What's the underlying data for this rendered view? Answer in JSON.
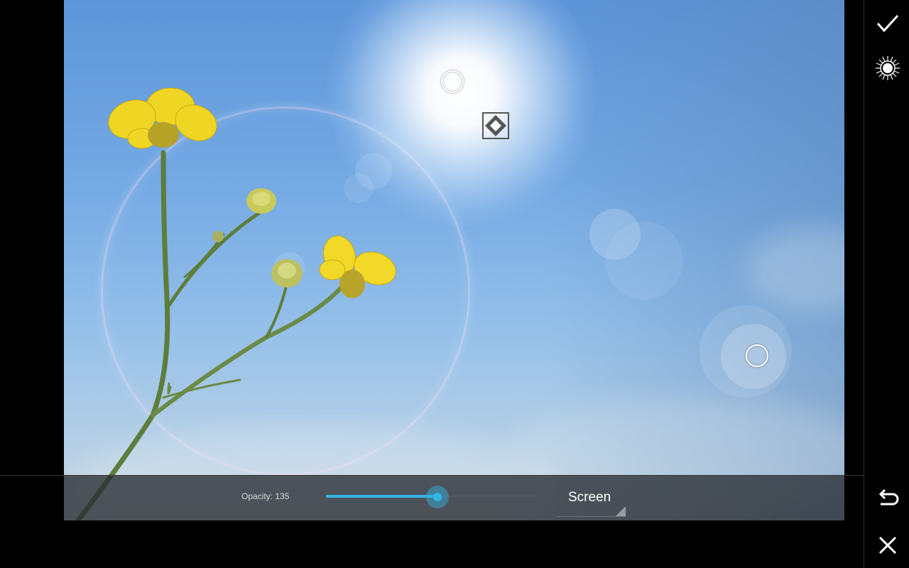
{
  "editor": {
    "opacity_label": "Opacity: 135",
    "opacity_value": 135,
    "opacity_max": 255,
    "blend_mode": "Screen",
    "accent_color": "#33b5e5"
  },
  "toolbar": {
    "apply_icon": "check-icon",
    "flare_icon": "lens-flare-icon",
    "undo_icon": "undo-icon",
    "cancel_icon": "close-icon"
  }
}
